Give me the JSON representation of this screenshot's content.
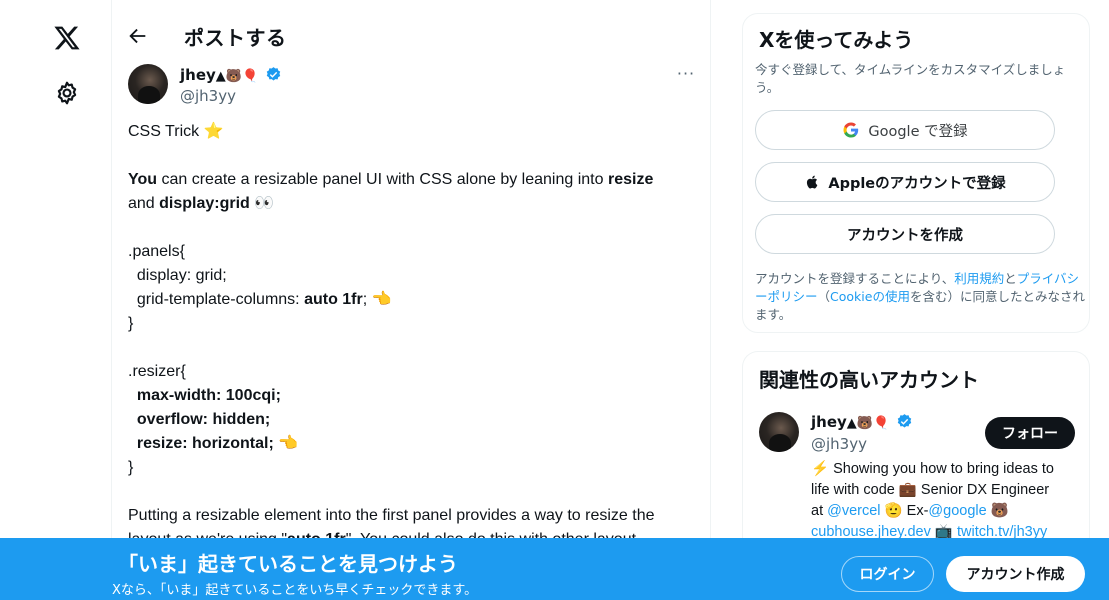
{
  "nav": {
    "logo_icon": "x-logo-icon",
    "settings_icon": "gear-icon"
  },
  "header": {
    "title": "ポストする"
  },
  "post": {
    "author_name": "jhey",
    "author_emojis": "▲🐻🎈",
    "handle": "@jh3yy",
    "more_label": "···",
    "lines": [
      {
        "segments": [
          {
            "text": "CSS Trick ⭐",
            "bold": false
          }
        ]
      },
      {
        "gap": true
      },
      {
        "segments": [
          {
            "text": "You",
            "bold": true
          },
          {
            "text": " can create a resizable panel UI with CSS alone by leaning into ",
            "bold": false
          },
          {
            "text": "resize",
            "bold": true
          }
        ]
      },
      {
        "segments": [
          {
            "text": "and ",
            "bold": false
          },
          {
            "text": "display:grid",
            "bold": true
          },
          {
            "text": " 👀",
            "bold": false
          }
        ]
      },
      {
        "gap": true
      },
      {
        "segments": [
          {
            "text": ".panels{",
            "bold": false
          }
        ]
      },
      {
        "segments": [
          {
            "text": "  display: grid;",
            "bold": false
          }
        ]
      },
      {
        "segments": [
          {
            "text": "  grid-template-columns: ",
            "bold": false
          },
          {
            "text": "auto 1fr",
            "bold": true
          },
          {
            "text": "; 👈",
            "bold": false
          }
        ]
      },
      {
        "segments": [
          {
            "text": "}",
            "bold": false
          }
        ]
      },
      {
        "gap": true
      },
      {
        "segments": [
          {
            "text": ".resizer{",
            "bold": false
          }
        ]
      },
      {
        "segments": [
          {
            "text": "  max-width: 100cqi;",
            "bold": true
          }
        ]
      },
      {
        "segments": [
          {
            "text": "  overflow: hidden;",
            "bold": true
          }
        ]
      },
      {
        "segments": [
          {
            "text": "  resize: horizontal;",
            "bold": true
          },
          {
            "text": " 👈",
            "bold": false
          }
        ]
      },
      {
        "segments": [
          {
            "text": "}",
            "bold": false
          }
        ]
      },
      {
        "gap": true
      },
      {
        "segments": [
          {
            "text": "Putting a resizable element into the first panel provides a way to resize the",
            "bold": false
          }
        ]
      },
      {
        "segments": [
          {
            "text": "layout as we're using \"",
            "bold": false
          },
          {
            "text": "auto 1fr",
            "bold": true
          },
          {
            "text": "\". You could also do this with other layout",
            "bold": false
          }
        ]
      }
    ]
  },
  "signup_card": {
    "title": "Xを使ってみよう",
    "subtitle": "今すぐ登録して、タイムラインをカスタマイズしましょう。",
    "google_label": "Google で登録",
    "apple_label": "Appleのアカウントで登録",
    "create_label": "アカウントを作成",
    "terms_pre": "アカウントを登録することにより、",
    "terms_link": "利用規約",
    "terms_and": "と",
    "privacy_link": "プライバシーポリシー",
    "terms_mid": "（",
    "cookie_link": "Cookieの使用",
    "terms_post": "を含む）に同意したとみなされます。"
  },
  "recommend_card": {
    "title": "関連性の高いアカウント",
    "name": "jhey",
    "name_emojis": "▲🐻🎈",
    "handle": "@jh3yy",
    "follow_label": "フォロー",
    "bio_line1": "⚡ Showing you how to bring ideas to",
    "bio_line2": "life with code 💼 Senior DX Engineer",
    "bio_at": "at ",
    "bio_vercel": "@vercel",
    "bio_ex": " 🫡 Ex-",
    "bio_google": "@google",
    "bio_bear": " 🐻",
    "bio_cubhouse": "cubhouse.jhey.dev",
    "bio_tv": " 📺 ",
    "bio_twitch": "twitch.tv/jh3yy"
  },
  "bottom_bar": {
    "title": "「いま」起きていることを見つけよう",
    "subtitle": "Xなら、「いま」起きていることをいち早くチェックできます。",
    "login_label": "ログイン",
    "signup_label": "アカウント作成"
  },
  "colors": {
    "accent": "#1d9bf0",
    "text": "#0f1419",
    "muted": "#536471"
  }
}
